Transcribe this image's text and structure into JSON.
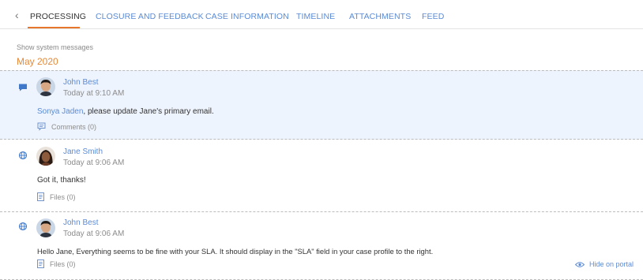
{
  "tabs": [
    {
      "label": "PROCESSING",
      "active": true
    },
    {
      "label": "CLOSURE AND FEEDBACK",
      "active": false
    },
    {
      "label": "CASE INFORMATION",
      "active": false
    },
    {
      "label": "TIMELINE",
      "active": false
    },
    {
      "label": "ATTACHMENTS",
      "active": false
    },
    {
      "label": "FEED",
      "active": false
    }
  ],
  "feed": {
    "show_system_messages": "Show system messages",
    "month": "May 2020",
    "posts": [
      {
        "type_icon": "chat-bubble-icon",
        "author": "John Best",
        "time": "Today at 9:10 AM",
        "mention": "Sonya Jaden",
        "message": ", please update Jane's primary email.",
        "action_icon": "comment-icon",
        "action": "Comments (0)"
      },
      {
        "type_icon": "globe-icon",
        "author": "Jane Smith",
        "time": "Today at 9:06 AM",
        "message": "Got it, thanks!",
        "action_icon": "file-icon",
        "action": "Files (0)"
      },
      {
        "type_icon": "globe-icon",
        "author": "John Best",
        "time": "Today at 9:06 AM",
        "message": "Hello Jane, Everything seems to be fine with your SLA. It should display in the \"SLA\" field in your case profile to the right.",
        "action_icon": "file-icon",
        "action": "Files (0)",
        "hide_label": "Hide on portal"
      }
    ]
  },
  "colors": {
    "accent": "#e8772e",
    "link": "#5b8bd6",
    "highlight_bg": "#eef4fd"
  }
}
